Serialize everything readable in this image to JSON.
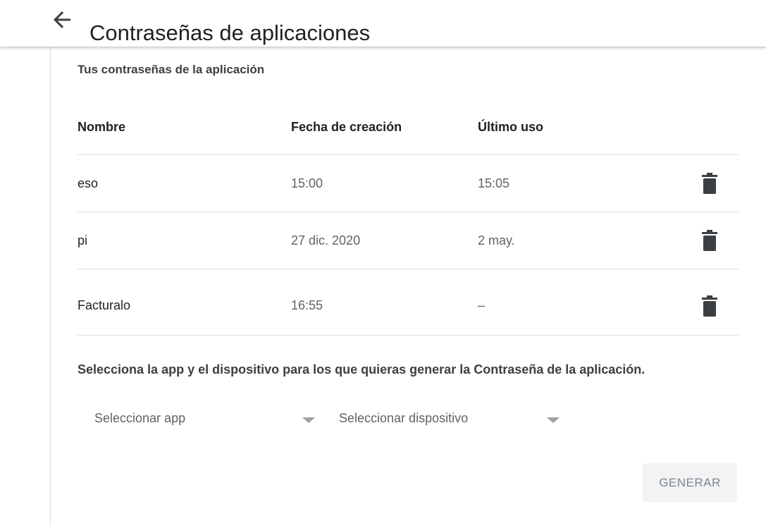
{
  "header": {
    "back_icon": "arrow-back-icon",
    "title": "Contraseñas de aplicaciones"
  },
  "passwords": {
    "heading": "Tus contraseñas de la aplicación",
    "columns": {
      "name": "Nombre",
      "created": "Fecha de creación",
      "last_used": "Último uso"
    },
    "rows": [
      {
        "name": "eso",
        "created": "15:00",
        "last_used": "15:05",
        "delete_icon": "trash-icon"
      },
      {
        "name": "pi",
        "created": "27 dic. 2020",
        "last_used": "2 may.",
        "delete_icon": "trash-icon"
      },
      {
        "name": "Facturalo",
        "created": "16:55",
        "last_used": "–",
        "delete_icon": "trash-icon"
      }
    ]
  },
  "generator": {
    "instructions": "Selecciona la app y el dispositivo para los que quieras generar la Contraseña de la aplicación.",
    "app_select": {
      "label": "Seleccionar app",
      "icon": "dropdown-arrow-icon"
    },
    "device_select": {
      "label": "Seleccionar dispositivo",
      "icon": "dropdown-arrow-icon"
    },
    "generate_label": "GENERAR"
  },
  "colors": {
    "text_primary": "#202124",
    "text_secondary": "#5f6368",
    "divider": "#e0e0e0",
    "button_disabled_bg": "#f1f3f4",
    "button_disabled_text": "#80868b",
    "icon": "#3c4043"
  }
}
